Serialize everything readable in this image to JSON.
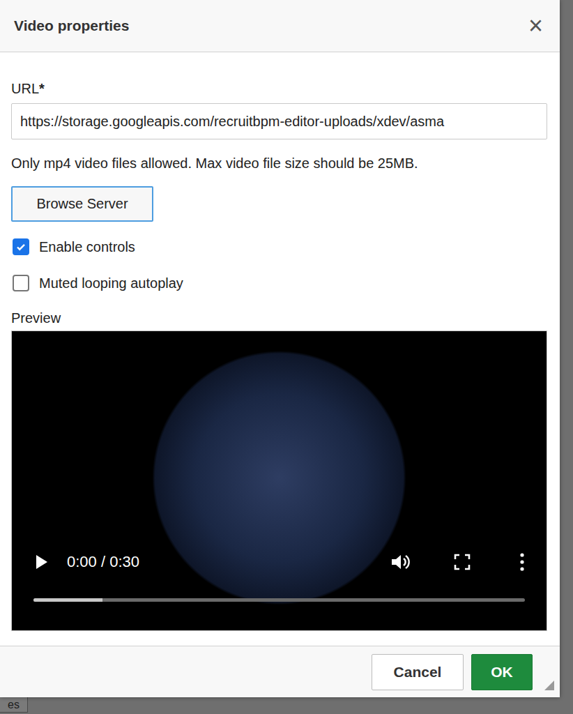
{
  "background": {
    "button_fragment": "es"
  },
  "dialog": {
    "title": "Video properties",
    "close": "×"
  },
  "url": {
    "label": "URL",
    "required_mark": "*",
    "value": "https://storage.googleapis.com/recruitbpm-editor-uploads/xdev/asma"
  },
  "hint": "Only mp4 video files allowed. Max video file size should be 25MB.",
  "browse_button": "Browse Server",
  "options": [
    {
      "label": "Enable controls",
      "checked": true
    },
    {
      "label": "Muted looping autoplay",
      "checked": false
    }
  ],
  "preview": {
    "label": "Preview",
    "time": "0:00 / 0:30",
    "playing": false,
    "level": 0,
    "buffered": 0.14
  },
  "buttons": [
    {
      "label": "Cancel",
      "kind": "secondary"
    },
    {
      "label": "OK",
      "kind": "primary"
    }
  ]
}
